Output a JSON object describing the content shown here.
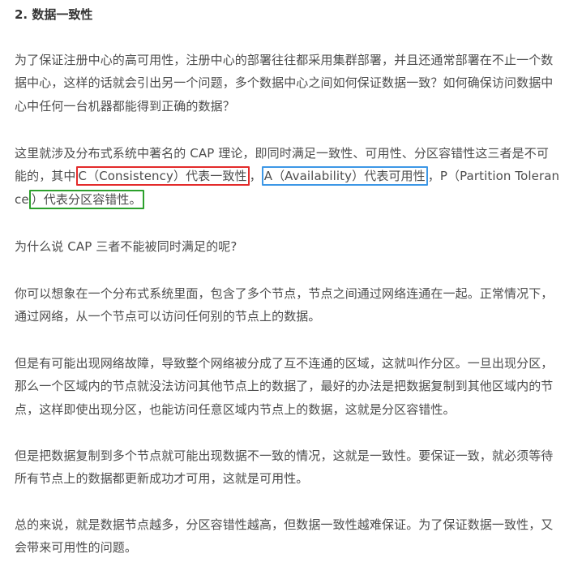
{
  "heading": "2. 数据一致性",
  "paragraphs": {
    "p1": "为了保证注册中心的高可用性，注册中心的部署往往都采用集群部署，并且还通常部署在不止一个数据中心，这样的话就会引出另一个问题，多个数据中心之间如何保证数据一致？如何确保访问数据中心中任何一台机器都能得到正确的数据？",
    "p2": {
      "before": "这里就涉及分布式系统中著名的 CAP 理论，即同时满足一致性、可用性、分区容错性这三者是不可能的，其中",
      "c_text": "C（Consistency）代表一致性",
      "sep1": "，",
      "a_text": "A（Availability）代表可用性",
      "sep2": "，P（Partition Tolerance",
      "p_text": "）代表分区容错性。"
    },
    "p3": "为什么说 CAP 三者不能被同时满足的呢?",
    "p4": "你可以想象在一个分布式系统里面，包含了多个节点，节点之间通过网络连通在一起。正常情况下，通过网络，从一个节点可以访问任何别的节点上的数据。",
    "p5": "但是有可能出现网络故障，导致整个网络被分成了互不连通的区域，这就叫作分区。一旦出现分区，那么一个区域内的节点就没法访问其他节点上的数据了，最好的办法是把数据复制到其他区域内的节点，这样即使出现分区，也能访问任意区域内节点上的数据，这就是分区容错性。",
    "p6": "但是把数据复制到多个节点就可能出现数据不一致的情况，这就是一致性。要保证一致，就必须等待所有节点上的数据都更新成功才可用，这就是可用性。",
    "p7": "总的来说，就是数据节点越多，分区容错性越高，但数据一致性越难保证。为了保证数据一致性，又会带来可用性的问题。"
  },
  "colors": {
    "text": "#4d4d4d",
    "heading": "#333333",
    "box_c": "#e32b2b",
    "box_a": "#3d97e6",
    "box_p": "#2ca02c"
  }
}
